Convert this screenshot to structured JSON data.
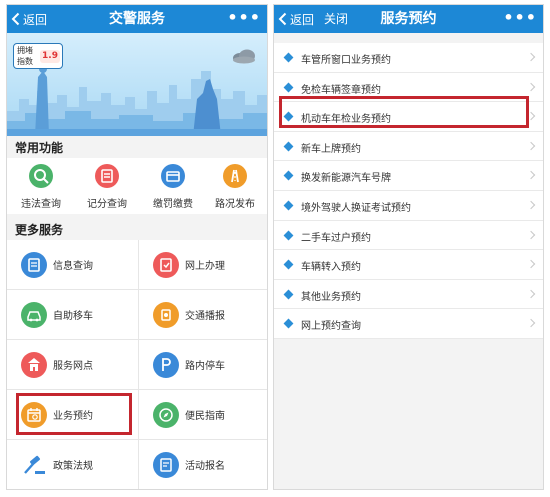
{
  "colors": {
    "nav": "#1d88d6",
    "accent": "#2b8fd7",
    "highlight": "#c4262e"
  },
  "left_screen": {
    "nav": {
      "back_label": "返回",
      "title": "交警服务",
      "more": "•••"
    },
    "banner": {
      "badge_label": "拥堵指数",
      "badge_value": "1.9",
      "icon": "cloud-icon"
    },
    "common_functions": {
      "title": "常用功能",
      "items": [
        {
          "label": "违法查询",
          "icon": "violation-check-icon",
          "color": "#4bb36a"
        },
        {
          "label": "记分查询",
          "icon": "points-check-icon",
          "color": "#ee5a5a"
        },
        {
          "label": "缴罚缴费",
          "icon": "fine-payment-icon",
          "color": "#3a89d8"
        },
        {
          "label": "路况发布",
          "icon": "road-condition-icon",
          "color": "#f09c2a"
        }
      ]
    },
    "more_services": {
      "title": "更多服务",
      "items": [
        {
          "label": "信息查询",
          "icon": "info-query-icon",
          "color": "#3a89d8"
        },
        {
          "label": "网上办理",
          "icon": "online-handling-icon",
          "color": "#ee5a5a"
        },
        {
          "label": "自助移车",
          "icon": "self-move-car-icon",
          "color": "#4bb36a"
        },
        {
          "label": "交通播报",
          "icon": "traffic-broadcast-icon",
          "color": "#f09c2a"
        },
        {
          "label": "服务网点",
          "icon": "service-outlet-icon",
          "color": "#ee5a5a"
        },
        {
          "label": "路内停车",
          "icon": "street-parking-icon",
          "color": "#3a89d8"
        },
        {
          "label": "业务预约",
          "icon": "business-booking-icon",
          "color": "#f09c2a"
        },
        {
          "label": "便民指南",
          "icon": "guide-icon",
          "color": "#4bb36a"
        },
        {
          "label": "政策法规",
          "icon": "policy-law-icon",
          "color": "#3a89d8"
        },
        {
          "label": "活动报名",
          "icon": "event-signup-icon",
          "color": "#3a89d8"
        }
      ]
    }
  },
  "right_screen": {
    "nav": {
      "back_label": "返回",
      "close_label": "关闭",
      "title": "服务预约",
      "more": "•••"
    },
    "items": [
      "车管所窗口业务预约",
      "免检车辆签章预约",
      "机动车年检业务预约",
      "新车上牌预约",
      "换发新能源汽车号牌",
      "境外驾驶人换证考试预约",
      "二手车过户预约",
      "车辆转入预约",
      "其他业务预约",
      "网上预约查询"
    ]
  }
}
